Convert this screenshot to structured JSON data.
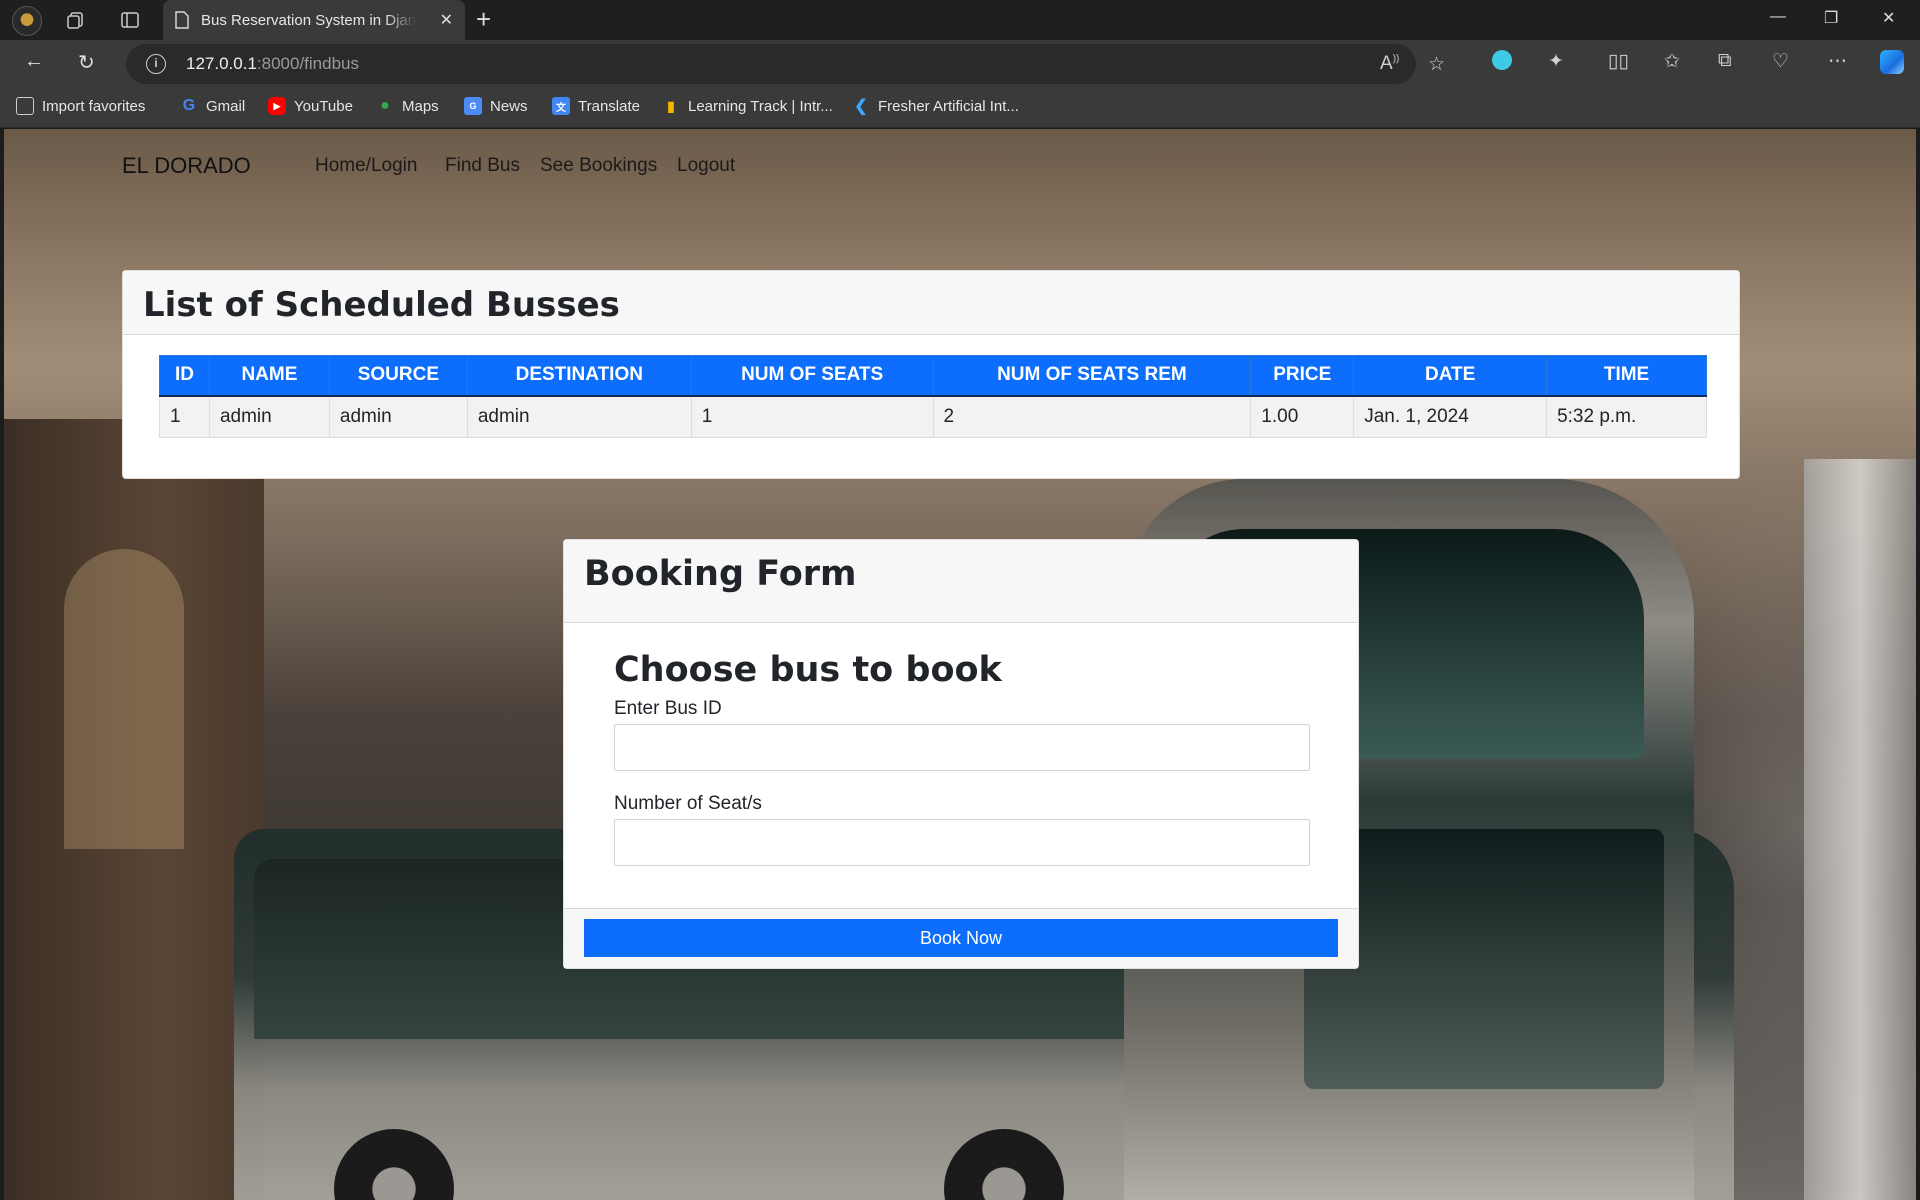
{
  "browser": {
    "tab_title": "Bus Reservation System in Django",
    "url_host": "127.0.0.1",
    "url_path": ":8000/findbus",
    "bookmarks": [
      {
        "label": "Import favorites",
        "icon": "import-icon",
        "color": "#cccccc"
      },
      {
        "label": "Gmail",
        "icon": "google-icon",
        "color": "#4285f4"
      },
      {
        "label": "YouTube",
        "icon": "youtube-icon",
        "color": "#ff0000"
      },
      {
        "label": "Maps",
        "icon": "maps-pin-icon",
        "color": "#34a853"
      },
      {
        "label": "News",
        "icon": "news-icon",
        "color": "#4c8bf5"
      },
      {
        "label": "Translate",
        "icon": "translate-icon",
        "color": "#4285f4"
      },
      {
        "label": "Learning Track | Intr...",
        "icon": "learning-track-icon",
        "color": "#f5b400"
      },
      {
        "label": "Fresher Artificial Int...",
        "icon": "fresher-icon",
        "color": "#3ea6ff"
      }
    ]
  },
  "site": {
    "brand": "EL DORADO",
    "nav": [
      "Home/Login",
      "Find Bus",
      "See Bookings",
      "Logout"
    ]
  },
  "buses": {
    "title": "List of Scheduled Busses",
    "columns": [
      "ID",
      "NAME",
      "SOURCE",
      "DESTINATION",
      "NUM OF SEATS",
      "NUM OF SEATS REM",
      "PRICE",
      "DATE",
      "TIME"
    ],
    "rows": [
      [
        "1",
        "admin",
        "admin",
        "admin",
        "1",
        "2",
        "1.00",
        "Jan. 1, 2024",
        "5:32 p.m."
      ]
    ]
  },
  "booking": {
    "title": "Booking Form",
    "subtitle": "Choose bus to book",
    "bus_id_label": "Enter Bus ID",
    "bus_id_value": "",
    "seats_label": "Number of Seat/s",
    "seats_value": "",
    "button": "Book Now"
  },
  "colors": {
    "primary": "#0d6efd",
    "header_bg": "#f7f7f7"
  }
}
